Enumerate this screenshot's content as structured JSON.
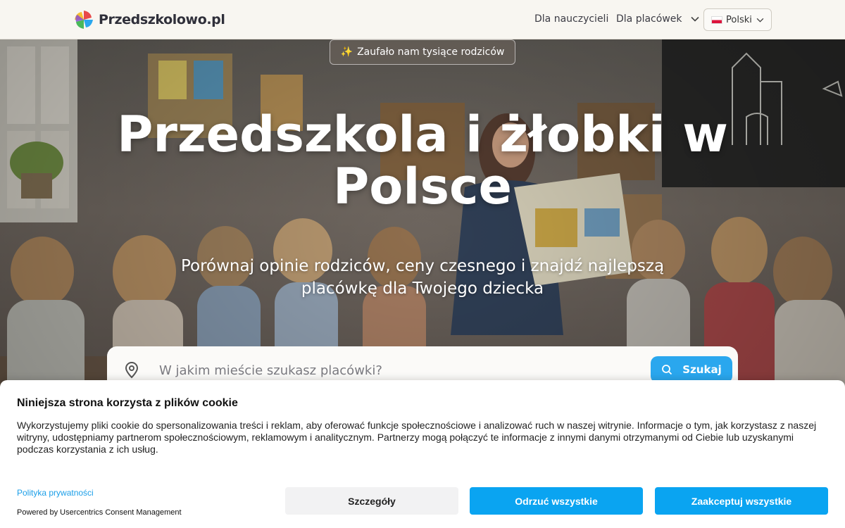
{
  "header": {
    "logo_text": "Przedszkolowo.pl",
    "nav": {
      "teachers": "Dla nauczycieli",
      "facilities": "Dla placówek"
    },
    "language": {
      "flag": "pl-flag-icon",
      "label": "Polski"
    }
  },
  "hero": {
    "badge_icon": "✨",
    "badge_text": "Zaufało nam tysiące rodziców",
    "title": "Przedszkola i żłobki w Polsce",
    "subtitle": "Porównaj opinie rodziców, ceny czesnego i znajdź najlepszą placówkę dla Twojego dziecka",
    "search": {
      "placeholder": "W jakim mieście szukasz placówki?",
      "button_label": "Szukaj"
    }
  },
  "cookie_banner": {
    "title": "Niniejsza strona korzysta z plików cookie",
    "text": "Wykorzystujemy pliki cookie do spersonalizowania treści i reklam, aby oferować funkcje społecznościowe i analizować ruch w naszej witrynie. Informacje o tym, jak korzystasz z naszej witryny, udostępniamy partnerom społecznościowym, reklamowym i analitycznym. Partnerzy mogą połączyć te informacje z innymi danymi otrzymanymi od Ciebie lub uzyskanymi podczas korzystania z ich usług.",
    "privacy_link": "Polityka prywatności",
    "powered_by": "Powered by Usercentrics Consent Management",
    "buttons": {
      "details": "Szczegóły",
      "deny": "Odrzuć wszystkie",
      "accept": "Zaakceptuj wszystkie"
    }
  },
  "colors": {
    "accent": "#2aa7ee",
    "cookie_buttons": "#0aa4f1"
  }
}
